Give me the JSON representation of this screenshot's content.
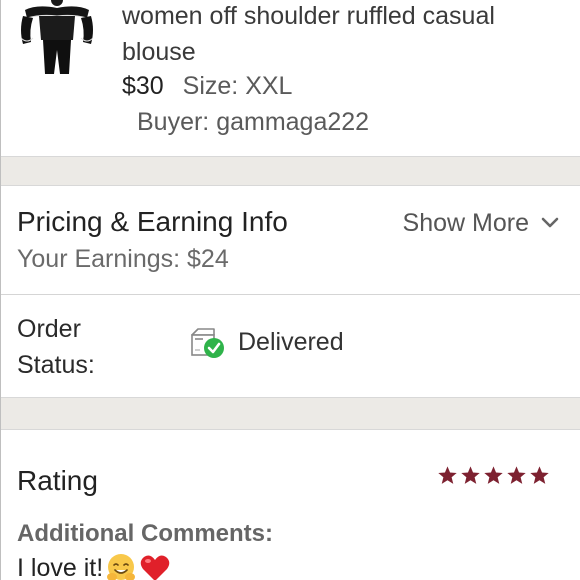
{
  "product": {
    "title": "women off shoulder ruffled casual blouse",
    "price": "$30",
    "size": "Size: XXL",
    "buyer": "Buyer: gammaga222",
    "thumbnail_icon": "blouse-thumbnail"
  },
  "pricing": {
    "title": "Pricing & Earning Info",
    "earnings": "Your Earnings: $24",
    "show_more_label": "Show More",
    "show_more_icon": "chevron-down-icon"
  },
  "order": {
    "label": "Order Status:",
    "status": "Delivered",
    "status_icon": "box-check-icon",
    "status_color": "#2fb34a"
  },
  "rating": {
    "title": "Rating",
    "stars": 5,
    "max_stars": 5,
    "star_color": "#7d2130",
    "comments_label": "Additional Comments:",
    "comment": "I love it!",
    "comment_emojis": [
      "hugging-face-emoji",
      "red-heart-emoji"
    ]
  },
  "colors": {
    "separator": "#eceae6",
    "divider": "#d5d5d5"
  }
}
